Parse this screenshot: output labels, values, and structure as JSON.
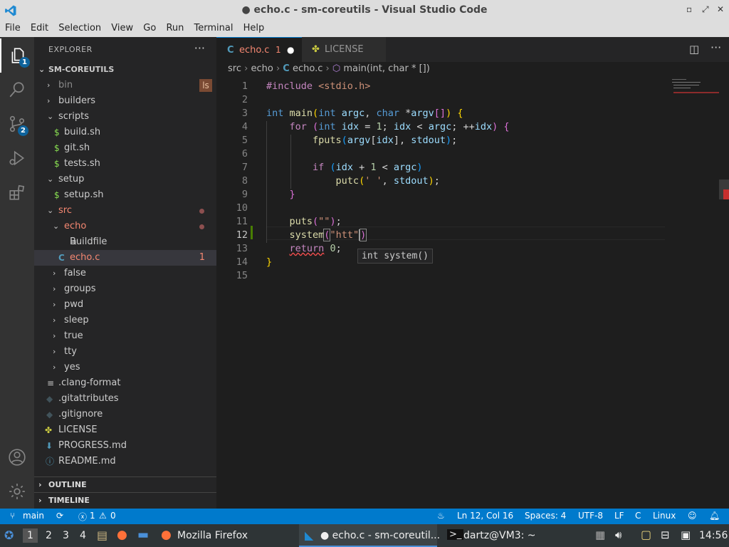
{
  "window": {
    "title": "● echo.c - sm-coreutils - Visual Studio Code"
  },
  "menu": [
    "File",
    "Edit",
    "Selection",
    "View",
    "Go",
    "Run",
    "Terminal",
    "Help"
  ],
  "activity_bar": {
    "explorer_badge": "1",
    "source_control_badge": "2"
  },
  "sidebar": {
    "header": "EXPLORER",
    "more": "···",
    "root": "SM-COREUTILS",
    "ls_badge": "ls",
    "tree": [
      {
        "label": "bin",
        "kind": "folder-closed"
      },
      {
        "label": "builders",
        "kind": "folder-closed"
      },
      {
        "label": "scripts",
        "kind": "folder-open"
      },
      {
        "label": "build.sh",
        "kind": "file-sh"
      },
      {
        "label": "git.sh",
        "kind": "file-sh"
      },
      {
        "label": "tests.sh",
        "kind": "file-sh"
      },
      {
        "label": "setup",
        "kind": "folder-open"
      },
      {
        "label": "setup.sh",
        "kind": "file-sh"
      },
      {
        "label": "src",
        "kind": "folder-open"
      },
      {
        "label": "echo",
        "kind": "folder-open"
      },
      {
        "label": "Buildfile",
        "kind": "file-text"
      },
      {
        "label": "echo.c",
        "kind": "file-c",
        "problems": "1"
      },
      {
        "label": "false",
        "kind": "folder-closed"
      },
      {
        "label": "groups",
        "kind": "folder-closed"
      },
      {
        "label": "pwd",
        "kind": "folder-closed"
      },
      {
        "label": "sleep",
        "kind": "folder-closed"
      },
      {
        "label": "true",
        "kind": "folder-closed"
      },
      {
        "label": "tty",
        "kind": "folder-closed"
      },
      {
        "label": "yes",
        "kind": "folder-closed"
      },
      {
        "label": ".clang-format",
        "kind": "file-text"
      },
      {
        "label": ".gitattributes",
        "kind": "file-git"
      },
      {
        "label": ".gitignore",
        "kind": "file-git"
      },
      {
        "label": "LICENSE",
        "kind": "file-license"
      },
      {
        "label": "PROGRESS.md",
        "kind": "file-md"
      },
      {
        "label": "README.md",
        "kind": "file-info"
      }
    ],
    "outline": "OUTLINE",
    "timeline": "TIMELINE"
  },
  "tabs": [
    {
      "icon": "C",
      "label": "echo.c",
      "problems": "1",
      "modified": "●"
    },
    {
      "label": "LICENSE"
    }
  ],
  "breadcrumb": {
    "p1": "src",
    "p2": "echo",
    "icon": "C",
    "p3": "echo.c",
    "p4": "main(int, char * [])"
  },
  "code": {
    "line_numbers": [
      "1",
      "2",
      "3",
      "4",
      "5",
      "6",
      "7",
      "8",
      "9",
      "10",
      "11",
      "12",
      "13",
      "14",
      "15"
    ],
    "tooltip": "int system()"
  },
  "status": {
    "branch": "main",
    "errors": "1",
    "warnings": "0",
    "position": "Ln 12, Col 16",
    "spaces": "Spaces: 4",
    "encoding": "UTF-8",
    "eol": "LF",
    "language": "C",
    "platform": "Linux"
  },
  "taskbar": {
    "workspaces": [
      "1",
      "2",
      "3",
      "4"
    ],
    "firefox": "Mozilla Firefox",
    "vscode": "● echo.c - sm-coreutil...",
    "terminal": "dartz@VM3: ~",
    "clock": "14:56"
  },
  "colors": {
    "accent": "#007acc",
    "error": "#f48771",
    "activity_bar": "#333333",
    "sidebar": "#252526",
    "editor": "#1e1e1e"
  }
}
